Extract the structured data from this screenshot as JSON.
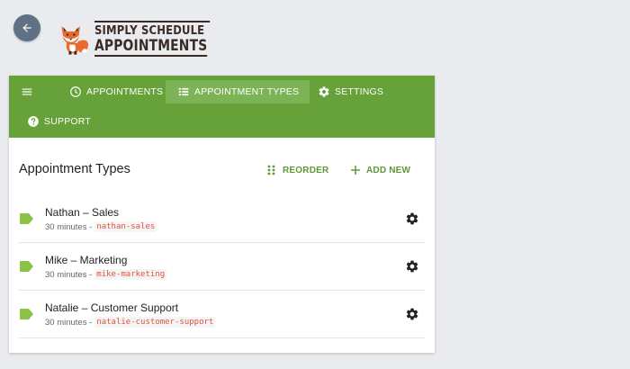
{
  "logo": {
    "line1": "SIMPLY SCHEDULE",
    "line2": "APPOINTMENTS"
  },
  "colors": {
    "nav_bg": "#66a13a",
    "nav_active": "#7db357",
    "accent": "#5c9a34",
    "slug": "#e0533a",
    "back_btn": "#5f7285"
  },
  "nav": {
    "menu_icon": "hamburger-icon",
    "items": [
      {
        "label": "APPOINTMENTS",
        "icon": "clock-icon"
      },
      {
        "label": "APPOINTMENT TYPES",
        "icon": "list-icon",
        "active": true
      },
      {
        "label": "SETTINGS",
        "icon": "gear-icon"
      },
      {
        "label": "SUPPORT",
        "icon": "help-icon"
      }
    ]
  },
  "header": {
    "title": "Appointment Types",
    "reorder_label": "REORDER",
    "add_label": "ADD NEW"
  },
  "appointment_types": [
    {
      "name": "Nathan – Sales",
      "duration": "30 minutes -",
      "slug": "nathan-sales"
    },
    {
      "name": "Mike – Marketing",
      "duration": "30 minutes -",
      "slug": "mike-marketing"
    },
    {
      "name": "Natalie – Customer Support",
      "duration": "30 minutes -",
      "slug": "natalie-customer-support"
    }
  ]
}
